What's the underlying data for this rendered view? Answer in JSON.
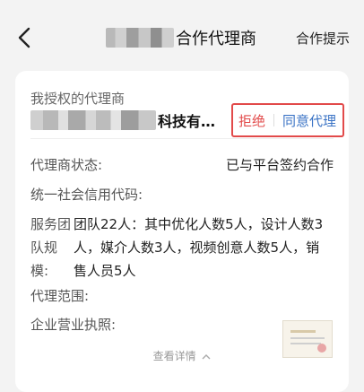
{
  "nav": {
    "title": "合作代理商",
    "right_action": "合作提示"
  },
  "card": {
    "section_label": "我授权的代理商",
    "company_suffix": "科技有…",
    "reject_label": "拒绝",
    "agree_label": "同意代理",
    "status_label": "代理商状态:",
    "status_value": "已与平台签约合作",
    "credit_label": "统一社会信用代码:",
    "team_label": "服务团队规模:",
    "team_value": "团队22人：其中优化人数5人，设计人数3人，媒介人数3人，视频创意人数5人，销售人员5人",
    "scope_label": "代理范围:",
    "license_label": "企业营业执照:",
    "more_label": "查看详情"
  },
  "colors": {
    "reject": "#e24a4a",
    "agree": "#3a73c5",
    "highlight_border": "#e24a4a"
  },
  "icons": [
    "back-arrow-icon",
    "chevron-up-icon"
  ]
}
